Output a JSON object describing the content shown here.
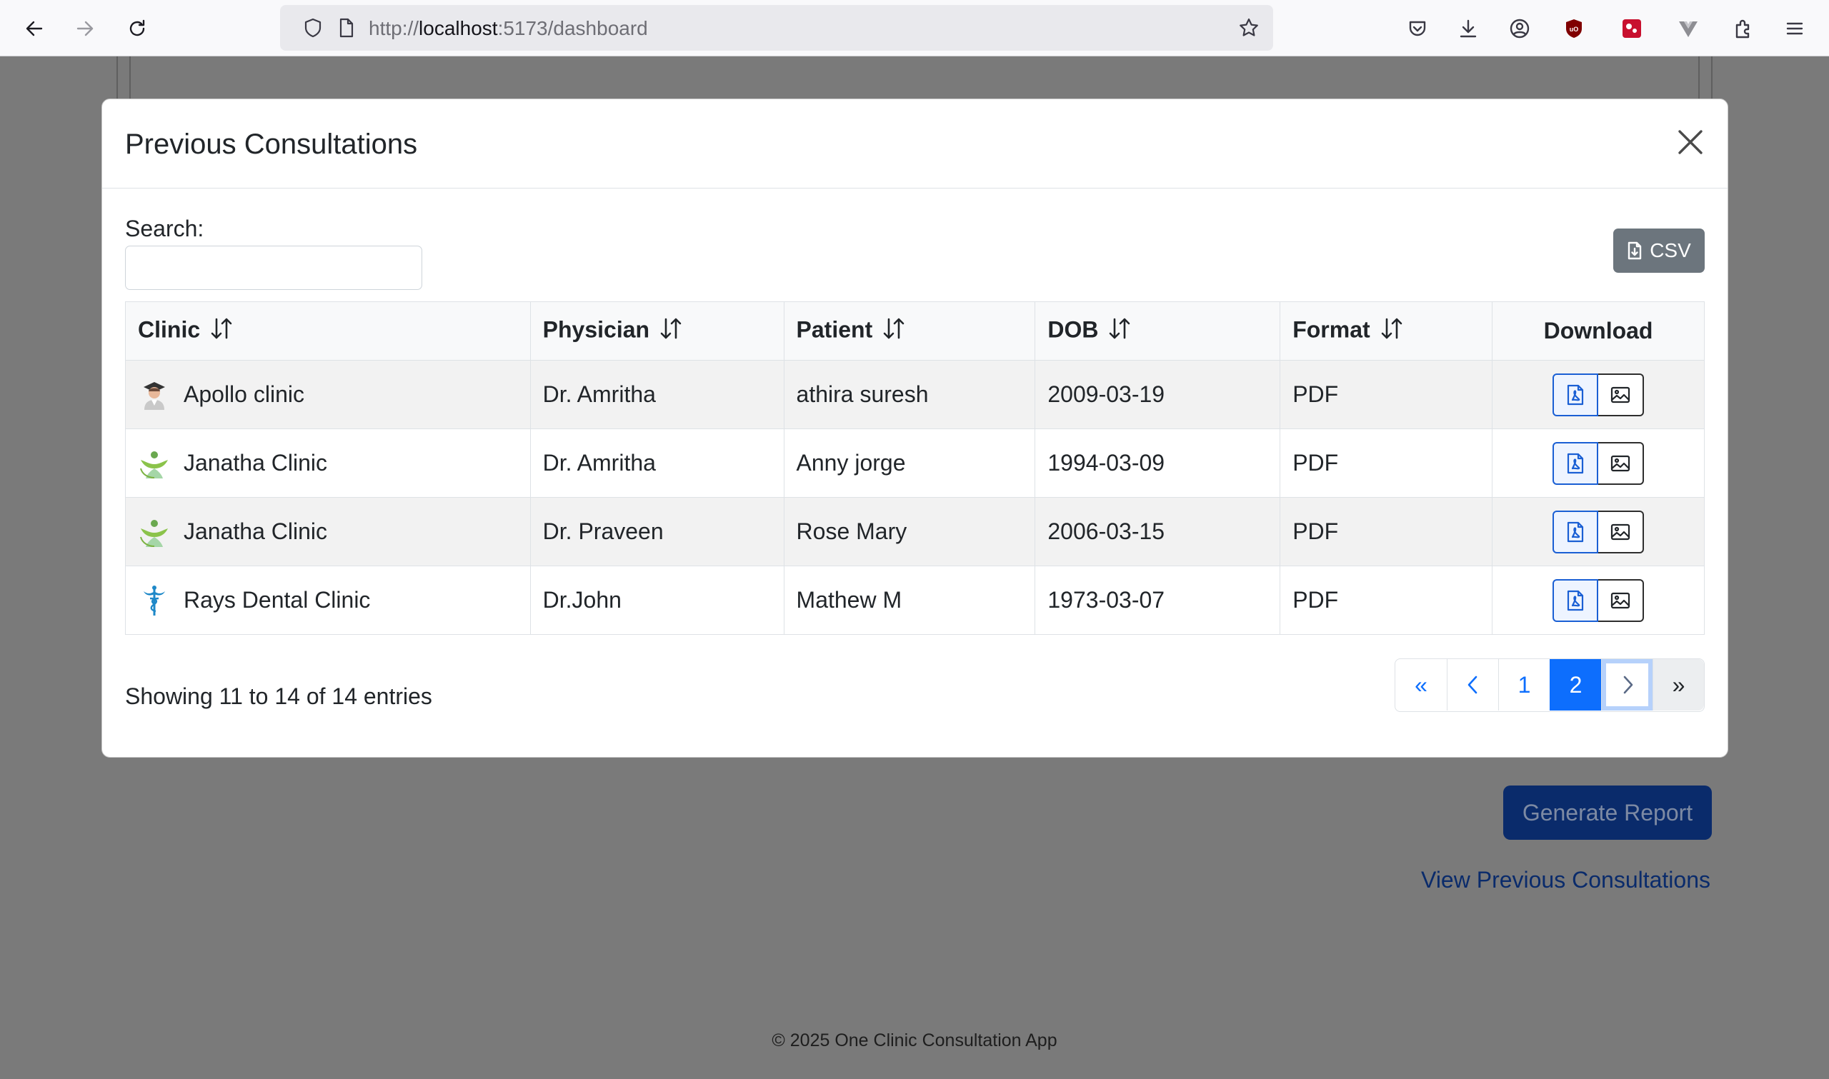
{
  "browser": {
    "url_prefix": "http://",
    "url_host": "localhost",
    "url_rest": ":5173/dashboard"
  },
  "modal": {
    "title": "Previous Consultations",
    "search_label": "Search:",
    "search_value": "",
    "csv_label": "CSV",
    "columns": [
      "Clinic",
      "Physician",
      "Patient",
      "DOB",
      "Format",
      "Download"
    ],
    "rows": [
      {
        "clinic": "Apollo clinic",
        "clinic_icon": "doctor-avatar-icon",
        "physician": "Dr. Amritha",
        "patient": "athira suresh",
        "dob": "2009-03-19",
        "format": "PDF"
      },
      {
        "clinic": "Janatha Clinic",
        "clinic_icon": "janatha-leaf-icon",
        "physician": "Dr. Amritha",
        "patient": "Anny jorge",
        "dob": "1994-03-09",
        "format": "PDF"
      },
      {
        "clinic": "Janatha Clinic",
        "clinic_icon": "janatha-leaf-icon",
        "physician": "Dr. Praveen",
        "patient": "Rose Mary",
        "dob": "2006-03-15",
        "format": "PDF"
      },
      {
        "clinic": "Rays Dental Clinic",
        "clinic_icon": "caduceus-icon",
        "physician": "Dr.John",
        "patient": "Mathew M",
        "dob": "1973-03-07",
        "format": "PDF"
      }
    ],
    "info": "Showing 11 to 14 of 14 entries",
    "pagination": {
      "first": "«",
      "page1": "1",
      "page2": "2",
      "last": "»",
      "active_page": 2
    }
  },
  "background": {
    "generate_report": "Generate Report",
    "view_previous": "View Previous Consultations",
    "footer": "© 2025 One Clinic Consultation App"
  },
  "colors": {
    "primary": "#0d6efd",
    "secondary": "#6c757d",
    "backdrop": "#7a7a7a"
  }
}
